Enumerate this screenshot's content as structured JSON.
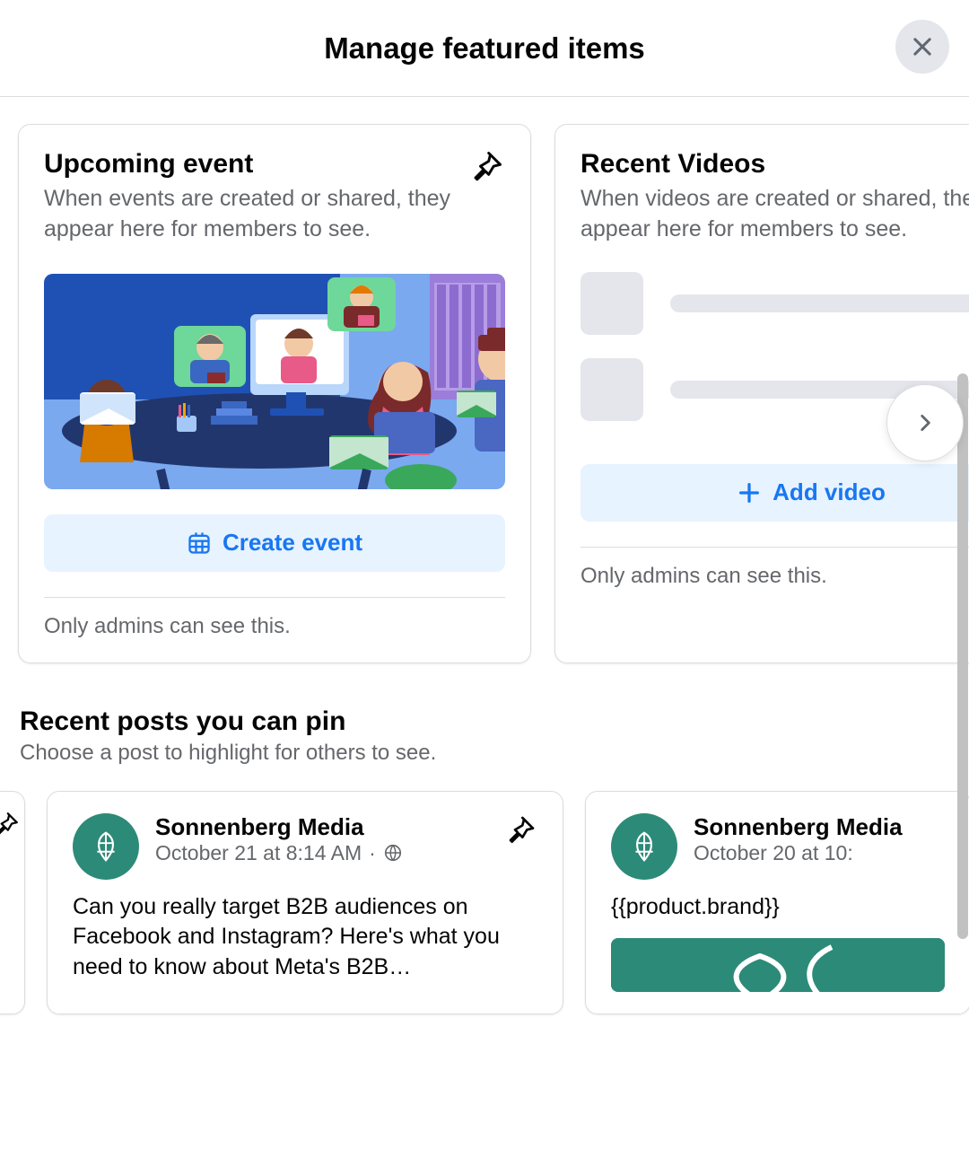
{
  "header": {
    "title": "Manage featured items"
  },
  "cards": {
    "event": {
      "title": "Upcoming event",
      "desc": "When events are created or shared, they appear here for members to see.",
      "action_label": "Create event",
      "admin_note": "Only admins can see this."
    },
    "videos": {
      "title": "Recent Videos",
      "desc": "When videos are created or shared, they appear here for members to see.",
      "action_label": "Add video",
      "admin_note": "Only admins can see this."
    }
  },
  "recent_posts": {
    "title": "Recent posts you can pin",
    "subtitle": "Choose a post to highlight for others to see.",
    "items": [
      {
        "author": "Sonnenberg Media",
        "time": "October 21 at 8:14 AM",
        "text": "Can you really target B2B audiences on Facebook and Instagram? Here's what you need to know about Meta's B2B…"
      },
      {
        "author": "Sonnenberg Media",
        "time": "October 20 at 10:",
        "text": "{{product.brand}}"
      }
    ]
  }
}
